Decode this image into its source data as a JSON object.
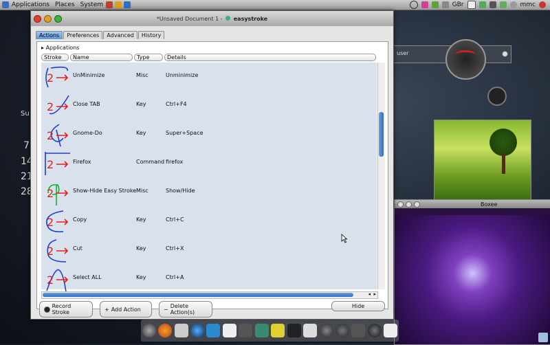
{
  "topbar": {
    "menus": [
      "Applications",
      "Places",
      "System"
    ],
    "indicator": "GBr",
    "user": "mmc"
  },
  "desktop": {
    "calendar_head": "Su",
    "calendar_days": [
      "7",
      "14",
      "21",
      "28"
    ],
    "widget_title_fragment": "user",
    "media_title": "Boxee"
  },
  "window": {
    "title_prefix": "*Unsaved Document 1 -",
    "title_app": "easystroke",
    "tabs": [
      "Actions",
      "Preferences",
      "Advanced",
      "History"
    ],
    "active_tab": "Actions",
    "tree_group": "Applications",
    "columns": [
      "Stroke",
      "Name",
      "Type",
      "Details"
    ],
    "rows": [
      {
        "name": "UnMinimize",
        "type": "Misc",
        "details": "Unminimize"
      },
      {
        "name": "Close TAB",
        "type": "Key",
        "details": "Ctrl+F4"
      },
      {
        "name": "Gnome-Do",
        "type": "Key",
        "details": "Super+Space"
      },
      {
        "name": "Firefox",
        "type": "Command",
        "details": "firefox"
      },
      {
        "name": "Show-Hide Easy Stroke",
        "type": "Misc",
        "details": "Show/Hide"
      },
      {
        "name": "Copy",
        "type": "Key",
        "details": "Ctrl+C"
      },
      {
        "name": "Cut",
        "type": "Key",
        "details": "Ctrl+X"
      },
      {
        "name": "Select ALL",
        "type": "Key",
        "details": "Ctrl+A"
      }
    ],
    "stroke_marker": "2",
    "buttons": {
      "record": "Record Stroke",
      "add": "Add Action",
      "delete": "Delete Action(s)",
      "hide": "Hide"
    }
  },
  "colors": {
    "selected_tab": "#5e97d8",
    "row_bg": "#d9e1ec",
    "stroke_red": "#e02020",
    "stroke_green": "#10b030",
    "stroke_blue": "#1c3fd0"
  }
}
